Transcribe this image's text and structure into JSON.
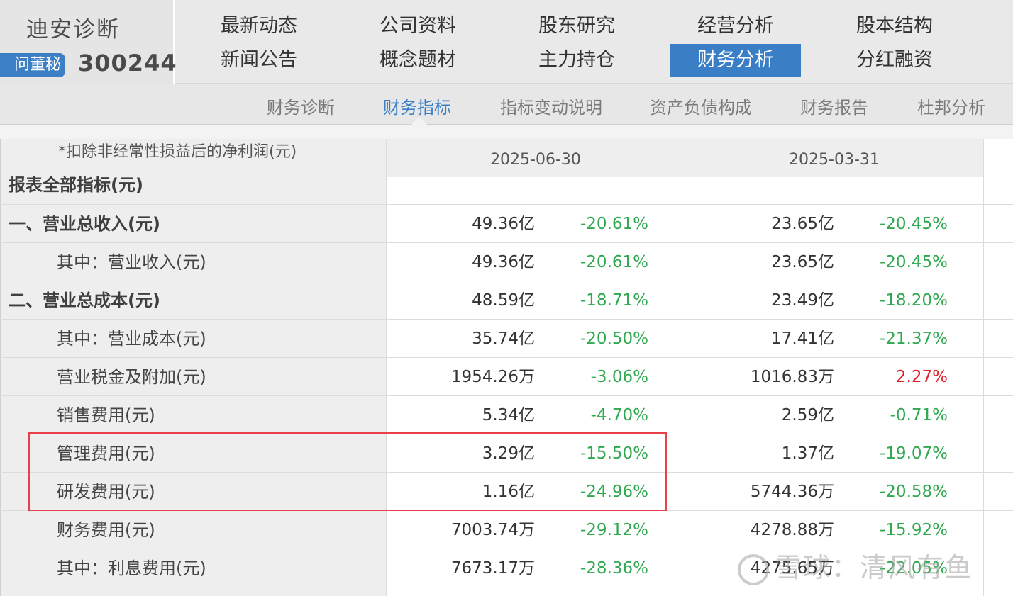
{
  "brand": {
    "name": "迪安诊断",
    "badge": "问董秘",
    "code": "300244"
  },
  "nav": [
    {
      "label": "最新动态",
      "active": false
    },
    {
      "label": "公司资料",
      "active": false
    },
    {
      "label": "股东研究",
      "active": false
    },
    {
      "label": "经营分析",
      "active": false
    },
    {
      "label": "股本结构",
      "active": false
    },
    {
      "label": "新闻公告",
      "active": false
    },
    {
      "label": "概念题材",
      "active": false
    },
    {
      "label": "主力持仓",
      "active": false
    },
    {
      "label": "财务分析",
      "active": true
    },
    {
      "label": "分红融资",
      "active": false
    }
  ],
  "subnav": [
    {
      "label": "财务诊断",
      "active": false
    },
    {
      "label": "财务指标",
      "active": true
    },
    {
      "label": "指标变动说明",
      "active": false
    },
    {
      "label": "资产负债构成",
      "active": false
    },
    {
      "label": "财务报告",
      "active": false
    },
    {
      "label": "杜邦分析",
      "active": false
    }
  ],
  "table": {
    "header_note": "*扣除非经常性损益后的净利润(元)",
    "dates": [
      "2025-06-30",
      "2025-03-31"
    ],
    "section_title": "报表全部指标(元)",
    "rows": [
      {
        "label": "一、营业总收入(元)",
        "bold": true,
        "v1": "49.36亿",
        "p1": "-20.61%",
        "v2": "23.65亿",
        "p2": "-20.45%"
      },
      {
        "label": "其中：营业收入(元)",
        "bold": false,
        "v1": "49.36亿",
        "p1": "-20.61%",
        "v2": "23.65亿",
        "p2": "-20.45%"
      },
      {
        "label": "二、营业总成本(元)",
        "bold": true,
        "v1": "48.59亿",
        "p1": "-18.71%",
        "v2": "23.49亿",
        "p2": "-18.20%"
      },
      {
        "label": "其中：营业成本(元)",
        "bold": false,
        "v1": "35.74亿",
        "p1": "-20.50%",
        "v2": "17.41亿",
        "p2": "-21.37%"
      },
      {
        "label": "营业税金及附加(元)",
        "bold": false,
        "v1": "1954.26万",
        "p1": "-3.06%",
        "v2": "1016.83万",
        "p2": "2.27%"
      },
      {
        "label": "销售费用(元)",
        "bold": false,
        "v1": "5.34亿",
        "p1": "-4.70%",
        "v2": "2.59亿",
        "p2": "-0.71%"
      },
      {
        "label": "管理费用(元)",
        "bold": false,
        "v1": "3.29亿",
        "p1": "-15.50%",
        "v2": "1.37亿",
        "p2": "-19.07%"
      },
      {
        "label": "研发费用(元)",
        "bold": false,
        "v1": "1.16亿",
        "p1": "-24.96%",
        "v2": "5744.36万",
        "p2": "-20.58%"
      },
      {
        "label": "财务费用(元)",
        "bold": false,
        "v1": "7003.74万",
        "p1": "-29.12%",
        "v2": "4278.88万",
        "p2": "-15.92%"
      },
      {
        "label": "其中：利息费用(元)",
        "bold": false,
        "v1": "7673.17万",
        "p1": "-28.36%",
        "v2": "4275.65万",
        "p2": "-22.05%"
      }
    ]
  },
  "watermark": "雪球：清风有鱼",
  "colors": {
    "accent": "#3a7fc5",
    "negative": "#2fa84f",
    "positive": "#e0202a",
    "highlight": "#e8414a"
  }
}
